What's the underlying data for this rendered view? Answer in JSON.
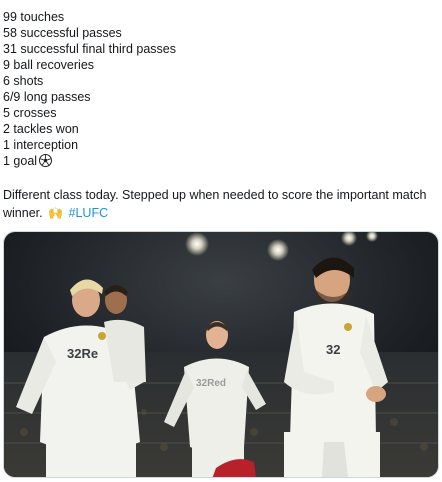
{
  "tweet": {
    "stats": [
      "99 touches",
      "58 successful passes",
      "31 successful final third passes",
      "9 ball recoveries",
      "6 shots",
      "6/9 long passes",
      "5 crosses",
      "2 tackles won",
      "1 interception",
      "1 goal"
    ],
    "body_text": "Different class today. Stepped up when needed to score the important match winner.",
    "hands_emoji": "🙌",
    "hashtag": "#LUFC",
    "media": {
      "kit_sponsor": "32Red",
      "shirt_badge_text": "32Re",
      "shirt_badge_text_mid": "32Red",
      "shirt_badge_text_right": "32"
    }
  },
  "colors": {
    "text": "#14171a",
    "link": "#1b95e0",
    "kit_white": "#f2f2ee",
    "crowd_dark": "#1f2326"
  }
}
